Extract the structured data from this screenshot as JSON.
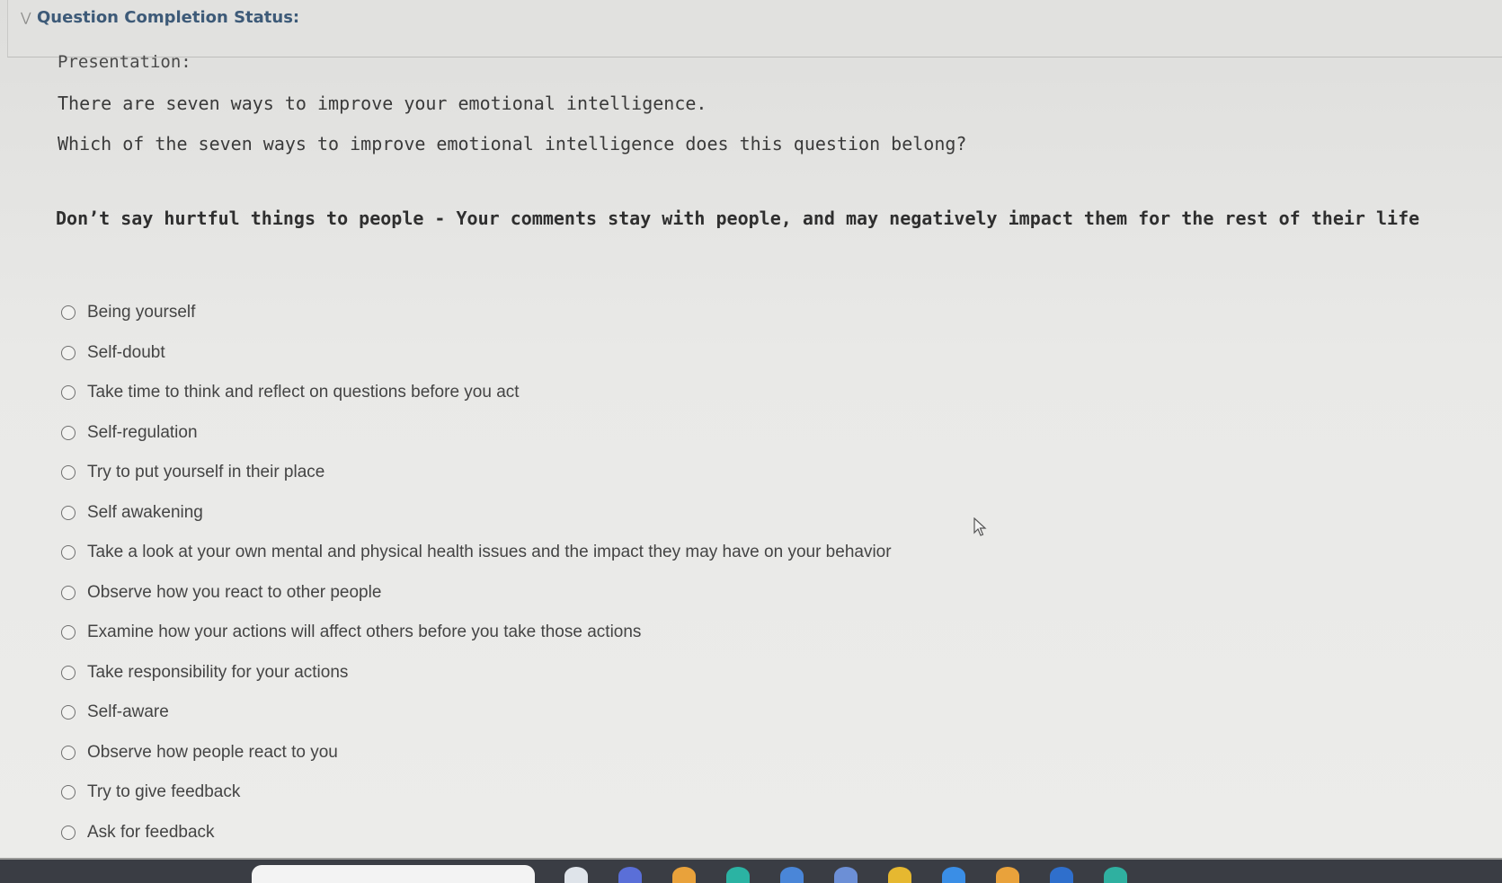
{
  "header": {
    "title": "Question Completion Status:"
  },
  "question": {
    "presentation_label": "Presentation:",
    "intro": "There are seven ways to improve your emotional intelligence.",
    "ask": "Which of the seven ways to improve emotional intelligence does this question belong?",
    "prompt": "Don’t say hurtful things to people - Your comments stay with people, and may negatively impact them for the rest of their life"
  },
  "options": [
    {
      "label": "Being yourself"
    },
    {
      "label": "Self-doubt"
    },
    {
      "label": "Take time to think and reflect on questions before you act"
    },
    {
      "label": "Self-regulation"
    },
    {
      "label": "Try to put yourself in their place"
    },
    {
      "label": "Self awakening"
    },
    {
      "label": "Take a look at your own mental and physical health issues and the impact they may have on  your behavior"
    },
    {
      "label": "Observe how you react to other people"
    },
    {
      "label": "Examine how your actions will affect others before you take those actions"
    },
    {
      "label": "Take responsibility for your actions"
    },
    {
      "label": "Self-aware"
    },
    {
      "label": "Observe how people react to you"
    },
    {
      "label": "Try to give feedback"
    },
    {
      "label": "Ask for feedback"
    }
  ],
  "taskbar": {
    "icons": [
      {
        "name": "mail-icon",
        "color": "#dfe4ea"
      },
      {
        "name": "browser-icon",
        "color": "#5a6fd8"
      },
      {
        "name": "folder-icon",
        "color": "#e9a23b"
      },
      {
        "name": "edge-icon",
        "color": "#2bb3a3"
      },
      {
        "name": "calculator-icon",
        "color": "#4a86d8"
      },
      {
        "name": "chat-icon",
        "color": "#6c8fd6"
      },
      {
        "name": "chrome-icon",
        "color": "#e6b830"
      },
      {
        "name": "store-icon",
        "color": "#3a8ee6"
      },
      {
        "name": "photos-icon",
        "color": "#e9a23b"
      },
      {
        "name": "word-icon",
        "color": "#2f6fcc"
      },
      {
        "name": "edge-dev-icon",
        "color": "#2fb0a0"
      }
    ]
  }
}
